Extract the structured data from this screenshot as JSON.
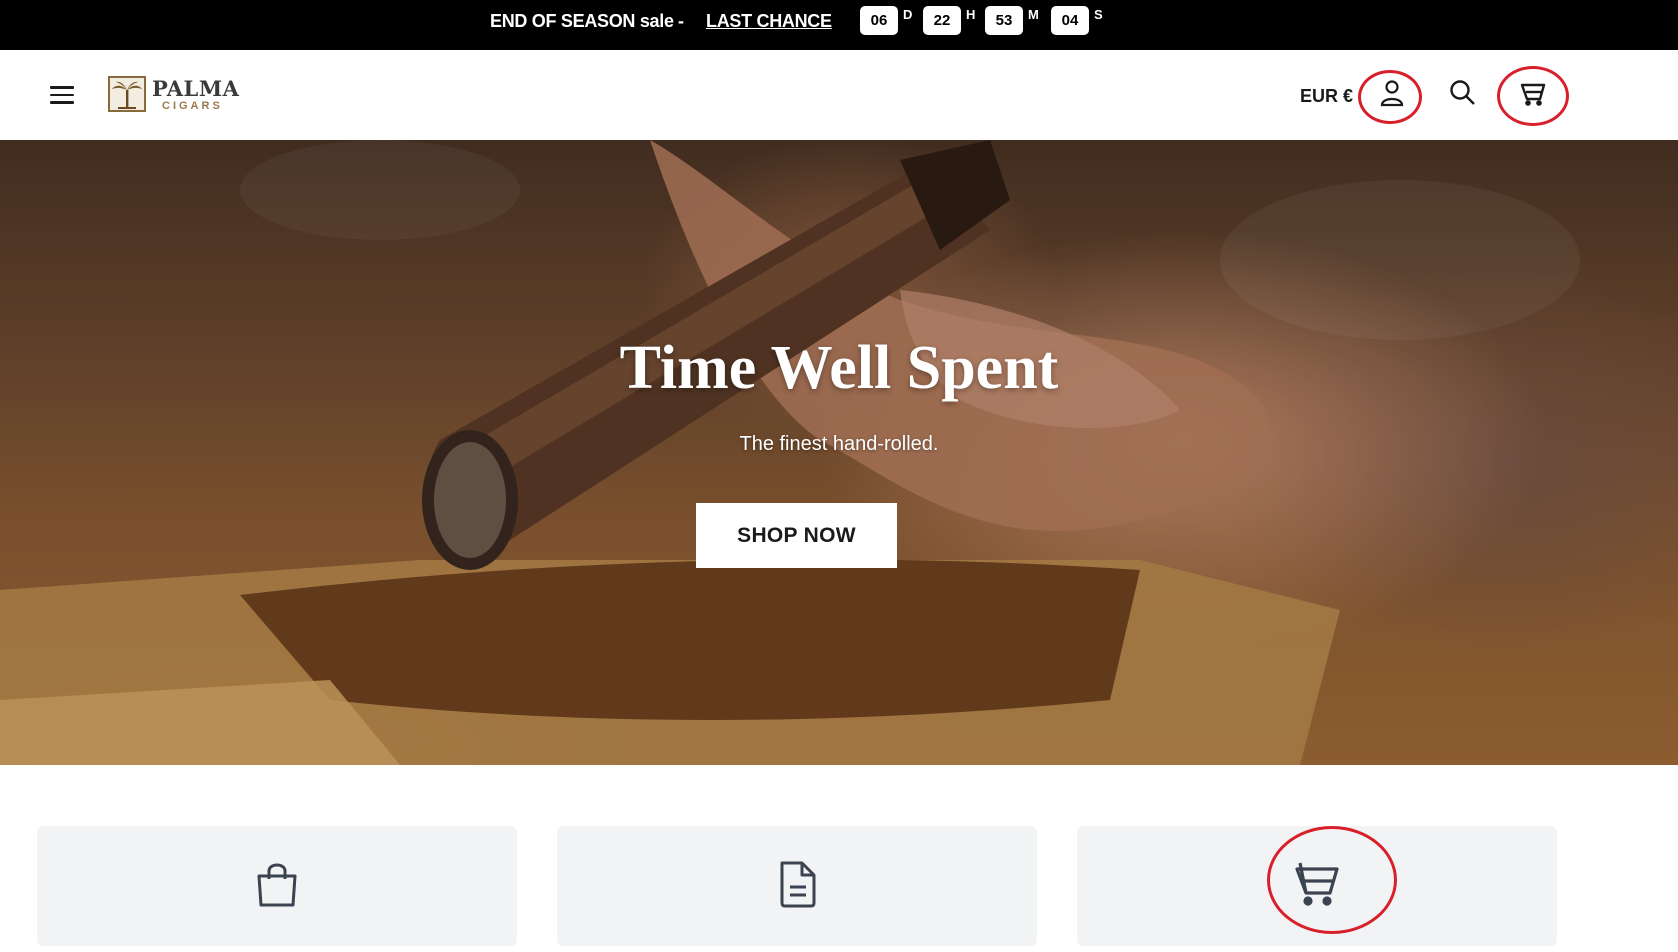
{
  "announcement": {
    "promo_text": "END OF SEASON sale",
    "separator": "-",
    "link_text": "LAST CHANCE",
    "countdown": [
      {
        "value": "06",
        "unit": "D"
      },
      {
        "value": "22",
        "unit": "H"
      },
      {
        "value": "53",
        "unit": "M"
      },
      {
        "value": "04",
        "unit": "S"
      }
    ]
  },
  "header": {
    "logo_name": "PALMA",
    "logo_sub": "CIGARS",
    "currency": "EUR €",
    "icons": [
      "menu-icon",
      "account-icon",
      "search-icon",
      "cart-icon"
    ]
  },
  "hero": {
    "title": "Time Well Spent",
    "subtitle": "The finest hand-rolled.",
    "button": "SHOP NOW"
  },
  "cards": {
    "icons": [
      "shopping-bag-icon",
      "document-icon",
      "cart-icon"
    ]
  },
  "colors": {
    "announcement_bg": "#000000",
    "highlight_ring": "#d8202a",
    "card_bg": "#f2f3f5",
    "logo_accent": "#9a7a4a"
  }
}
